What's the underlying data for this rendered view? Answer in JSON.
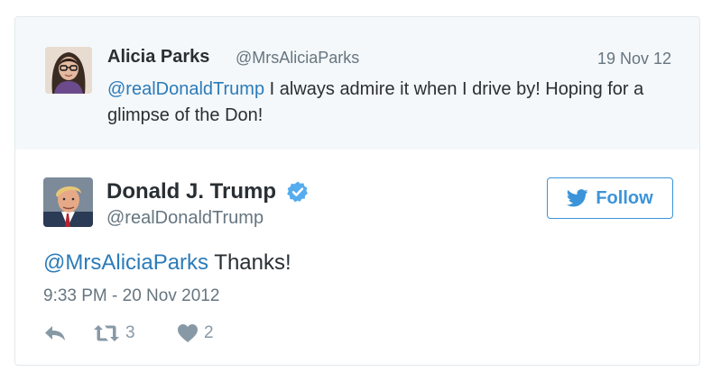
{
  "parent_tweet": {
    "name": "Alicia Parks",
    "handle": "@MrsAliciaParks",
    "date": "19 Nov 12",
    "mention": "@realDonaldTrump",
    "text": " I always admire it when I drive by! Hoping for a glimpse of the Don!"
  },
  "tweet": {
    "name": "Donald J. Trump",
    "handle": "@realDonaldTrump",
    "mention": "@MrsAliciaParks",
    "text": " Thanks!",
    "timestamp": "9:33 PM - 20 Nov 2012",
    "follow_label": "Follow",
    "retweet_count": "3",
    "like_count": "2"
  },
  "icons": {
    "verified": "verified-badge-icon",
    "follow": "bird-icon",
    "reply": "reply-icon",
    "retweet": "retweet-icon",
    "like": "heart-icon"
  },
  "colors": {
    "link": "#2b7bb9",
    "accent": "#3b94d9",
    "muted": "#66757f",
    "context_bg": "#f5f8fa"
  }
}
